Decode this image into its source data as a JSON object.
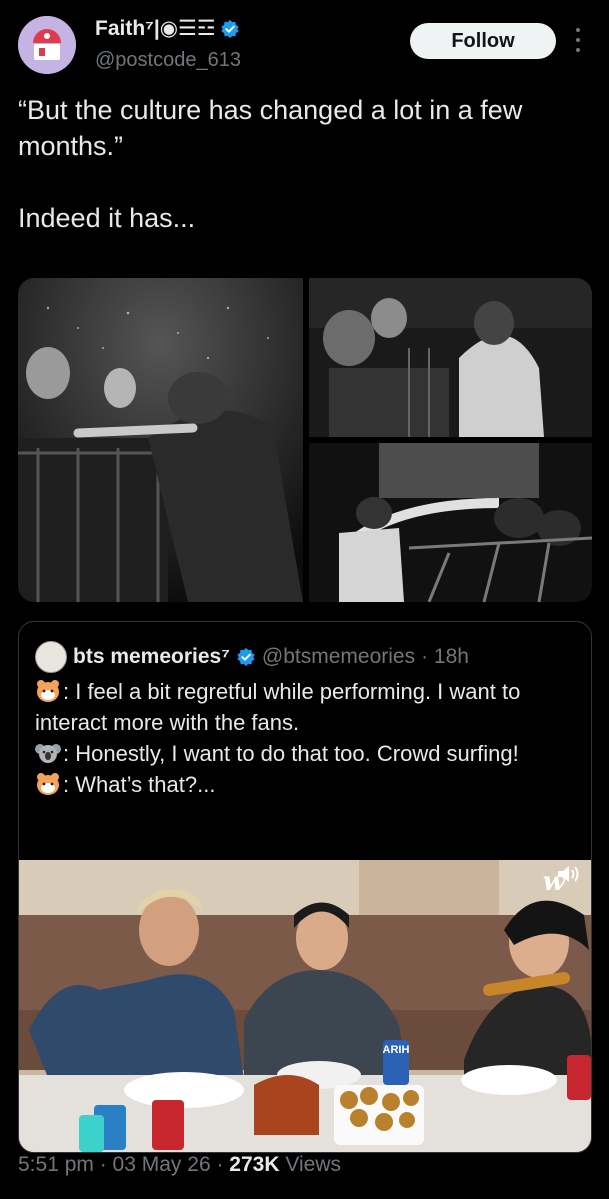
{
  "author": {
    "name": "Faith⁷|◉☰☲",
    "handle": "@postcode_613"
  },
  "follow_label": "Follow",
  "tweet_text": "“But the culture has changed a lot in a few months.”\n\nIndeed it has...",
  "quote": {
    "name": "bts memeories⁷",
    "handle": "@btsmemeories",
    "time": "· 18h",
    "lines": [
      ": I feel a bit regretful while performing. I want to interact more with the fans.",
      ": Honestly, I want to do that too. Crowd surfing!",
      ": What’s that?..."
    ],
    "speaker_icons": [
      "hamster-emoji-icon",
      "koala-emoji-icon",
      "hamster-emoji-icon"
    ],
    "video_watermark": "w",
    "can_label": "ARIH"
  },
  "meta": {
    "time": "5:51 pm",
    "date": "· 03 May 26 ·",
    "views_count": "273K",
    "views_label": "Views"
  },
  "colors": {
    "background": "#000000",
    "text": "#e7e9ea",
    "secondary": "#71767b",
    "verified": "#1d9bf0",
    "border": "#333639"
  }
}
